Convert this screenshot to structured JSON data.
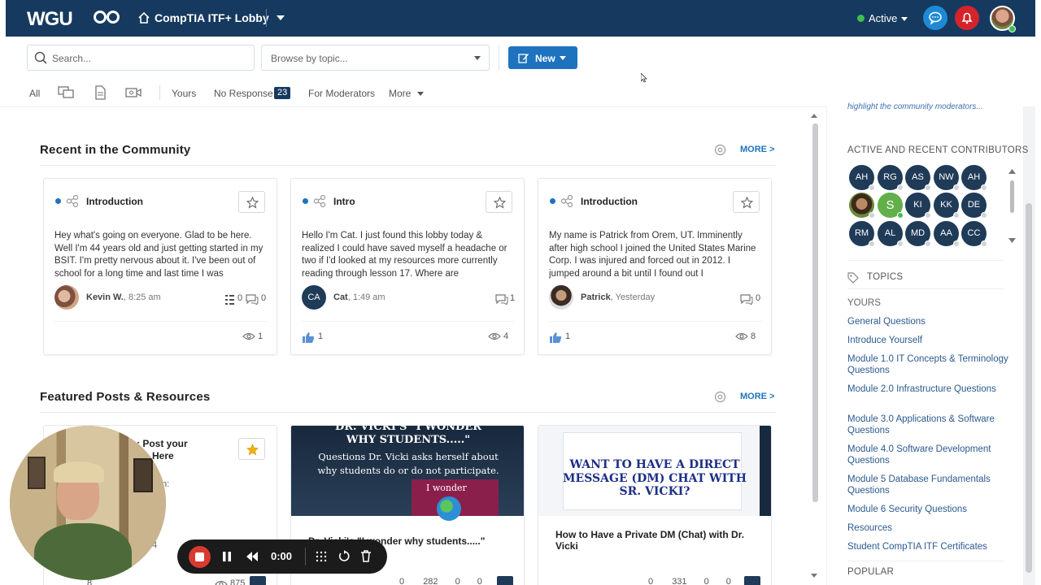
{
  "topnav": {
    "logo": "WGU",
    "lobby_title": "CompTIA ITF+ Lobby",
    "status": "Active"
  },
  "toolbar": {
    "search_placeholder": "Search...",
    "browse_placeholder": "Browse by topic...",
    "new_label": "New"
  },
  "filters": {
    "all": "All",
    "yours": "Yours",
    "no_response": "No Response",
    "no_response_count": "23",
    "for_moderators": "For Moderators",
    "more": "More"
  },
  "recent": {
    "title": "Recent in the Community",
    "more": "MORE >",
    "cards": [
      {
        "category": "Introduction",
        "body": "Hey what's going on everyone. Glad to be here. Well I'm 44 years old and just getting started in my BSIT. I'm pretty nervous about it. I've been out of school for a long time and last time I was",
        "author": "Kevin W.",
        "time": ", 8:25 am",
        "stat_a": "0",
        "stat_b": "0",
        "likes": "",
        "views": "1"
      },
      {
        "category": "Intro",
        "body": "Hello I'm Cat. I just found this lobby today & realized I could have saved myself a headache or two if I'd looked at my resources more currently reading through lesson 17. Where are",
        "author": "Cat",
        "avatar_initials": "CA",
        "time": ", 1:49 am",
        "stat_b": "1",
        "likes": "1",
        "views": "4"
      },
      {
        "category": "Introduction",
        "body": "My name is Patrick from Orem, UT.  Imminently after high school I joined the United States Marine Corp.  I was injured and forced out in 2012.  I jumped around a bit until I found out I",
        "author": "Patrick",
        "time": ", Yesterday",
        "stat_b": "0",
        "likes": "1",
        "views": "8"
      }
    ]
  },
  "featured": {
    "title": "Featured Posts & Resources",
    "more": "MORE >",
    "card1_title_a": "ns: Post your",
    "card1_title_b": "Here",
    "card1_frag_a": "n:",
    "card1_frag_b": "4",
    "card1_likes": "8",
    "card1_views": "875",
    "card2_banner_a": "DR. VICKI'S \"I WONDER",
    "card2_banner_b": "WHY STUDENTS.....\"",
    "card2_sub_a": "Questions Dr. Vicki asks herself about",
    "card2_sub_b": "why students do or do not participate.",
    "card2_wonder": "I wonder",
    "card2_title": "Dr. Vicki's \"I wonder why students.....\"",
    "card2_stats": [
      "0",
      "282",
      "0",
      "0"
    ],
    "card3_banner": "WANT TO HAVE A DIRECT MESSAGE (DM) CHAT WITH SR. VICKI?",
    "card3_title": "How to Have a Private DM (Chat) with Dr. Vicki",
    "card3_stats": [
      "0",
      "331",
      "0",
      "0"
    ]
  },
  "recorder": {
    "time": "0:00"
  },
  "rail": {
    "top_text": "highlight the community moderators...",
    "contributors_title": "ACTIVE AND RECENT CONTRIBUTORS",
    "contributors": [
      "AH",
      "RG",
      "AS",
      "NW",
      "AH",
      "",
      "S",
      "KI",
      "KK",
      "DE",
      "RM",
      "AL",
      "MD",
      "AA",
      "CC"
    ],
    "topics_title": "TOPICS",
    "topics": [
      "YOURS",
      "General Questions",
      "Introduce Yourself",
      "Module 1.0 IT Concepts & Terminology Questions",
      "Module 2.0 Infrastructure Questions",
      "Module 3.0 Applications & Software Questions",
      "Module 4.0 Software Development Questions",
      "Module 5 Database Fundamentals Questions",
      "Module 6 Security Questions",
      "Resources",
      "Student CompTIA ITF Certificates"
    ],
    "popular_title": "POPULAR"
  }
}
